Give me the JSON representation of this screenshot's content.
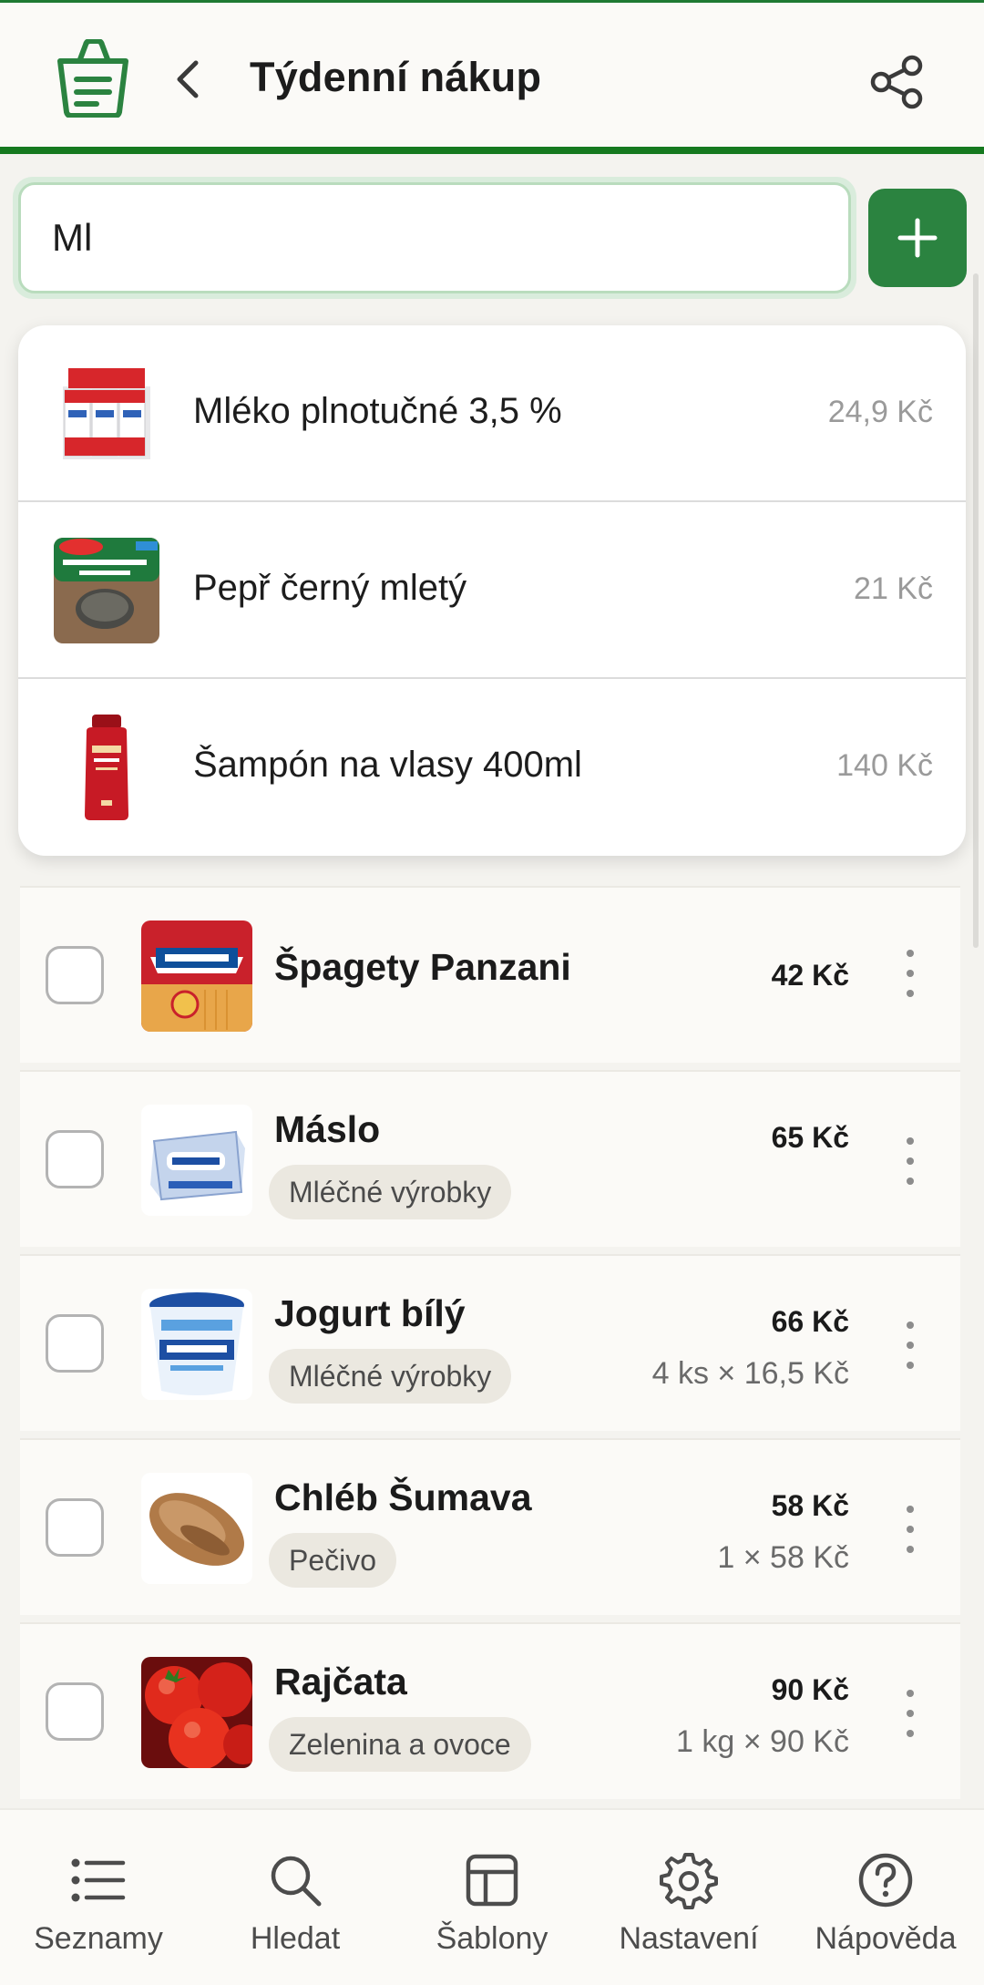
{
  "colors": {
    "brand_green": "#2b8340",
    "accent_bar": "#15791f",
    "muted_text": "#9a9a9a",
    "tag_bg": "#ebe8e0"
  },
  "header": {
    "title": "Týdenní nákup",
    "logo_icon": "shopping-basket-icon",
    "back_icon": "chevron-left-icon",
    "share_icon": "share-icon"
  },
  "search": {
    "value": "Ml",
    "add_icon": "plus-icon"
  },
  "suggestions": [
    {
      "name": "Mléko plnotučné 3,5 %",
      "price": "24,9 Kč",
      "image": "milk-carton-pack"
    },
    {
      "name": "Pepř černý mletý",
      "price": "21 Kč",
      "image": "black-pepper-box"
    },
    {
      "name": "Šampón na vlasy 400ml",
      "price": "140 Kč",
      "image": "shampoo-bottle"
    }
  ],
  "items": [
    {
      "name": "Špagety Panzani",
      "price": "42 Kč",
      "tag": "",
      "qty": "",
      "checked": false,
      "image": "spaghetti-package"
    },
    {
      "name": "Máslo",
      "price": "65 Kč",
      "tag": "Mléčné výrobky",
      "qty": "",
      "checked": false,
      "image": "butter-pack"
    },
    {
      "name": "Jogurt bílý",
      "price": "66 Kč",
      "tag": "Mléčné výrobky",
      "qty": "4 ks × 16,5 Kč",
      "checked": false,
      "image": "yogurt-cup"
    },
    {
      "name": "Chléb Šumava",
      "price": "58 Kč",
      "tag": "Pečivo",
      "qty": "1 × 58 Kč",
      "checked": false,
      "image": "bread-loaf"
    },
    {
      "name": "Rajčata",
      "price": "90 Kč",
      "tag": "Zelenina a ovoce",
      "qty": "1 kg × 90 Kč",
      "checked": false,
      "image": "tomatoes"
    }
  ],
  "nav": [
    {
      "label": "Seznamy",
      "icon": "list-icon"
    },
    {
      "label": "Hledat",
      "icon": "search-icon"
    },
    {
      "label": "Šablony",
      "icon": "template-icon"
    },
    {
      "label": "Nastavení",
      "icon": "gear-icon"
    },
    {
      "label": "Nápověda",
      "icon": "help-icon"
    }
  ]
}
